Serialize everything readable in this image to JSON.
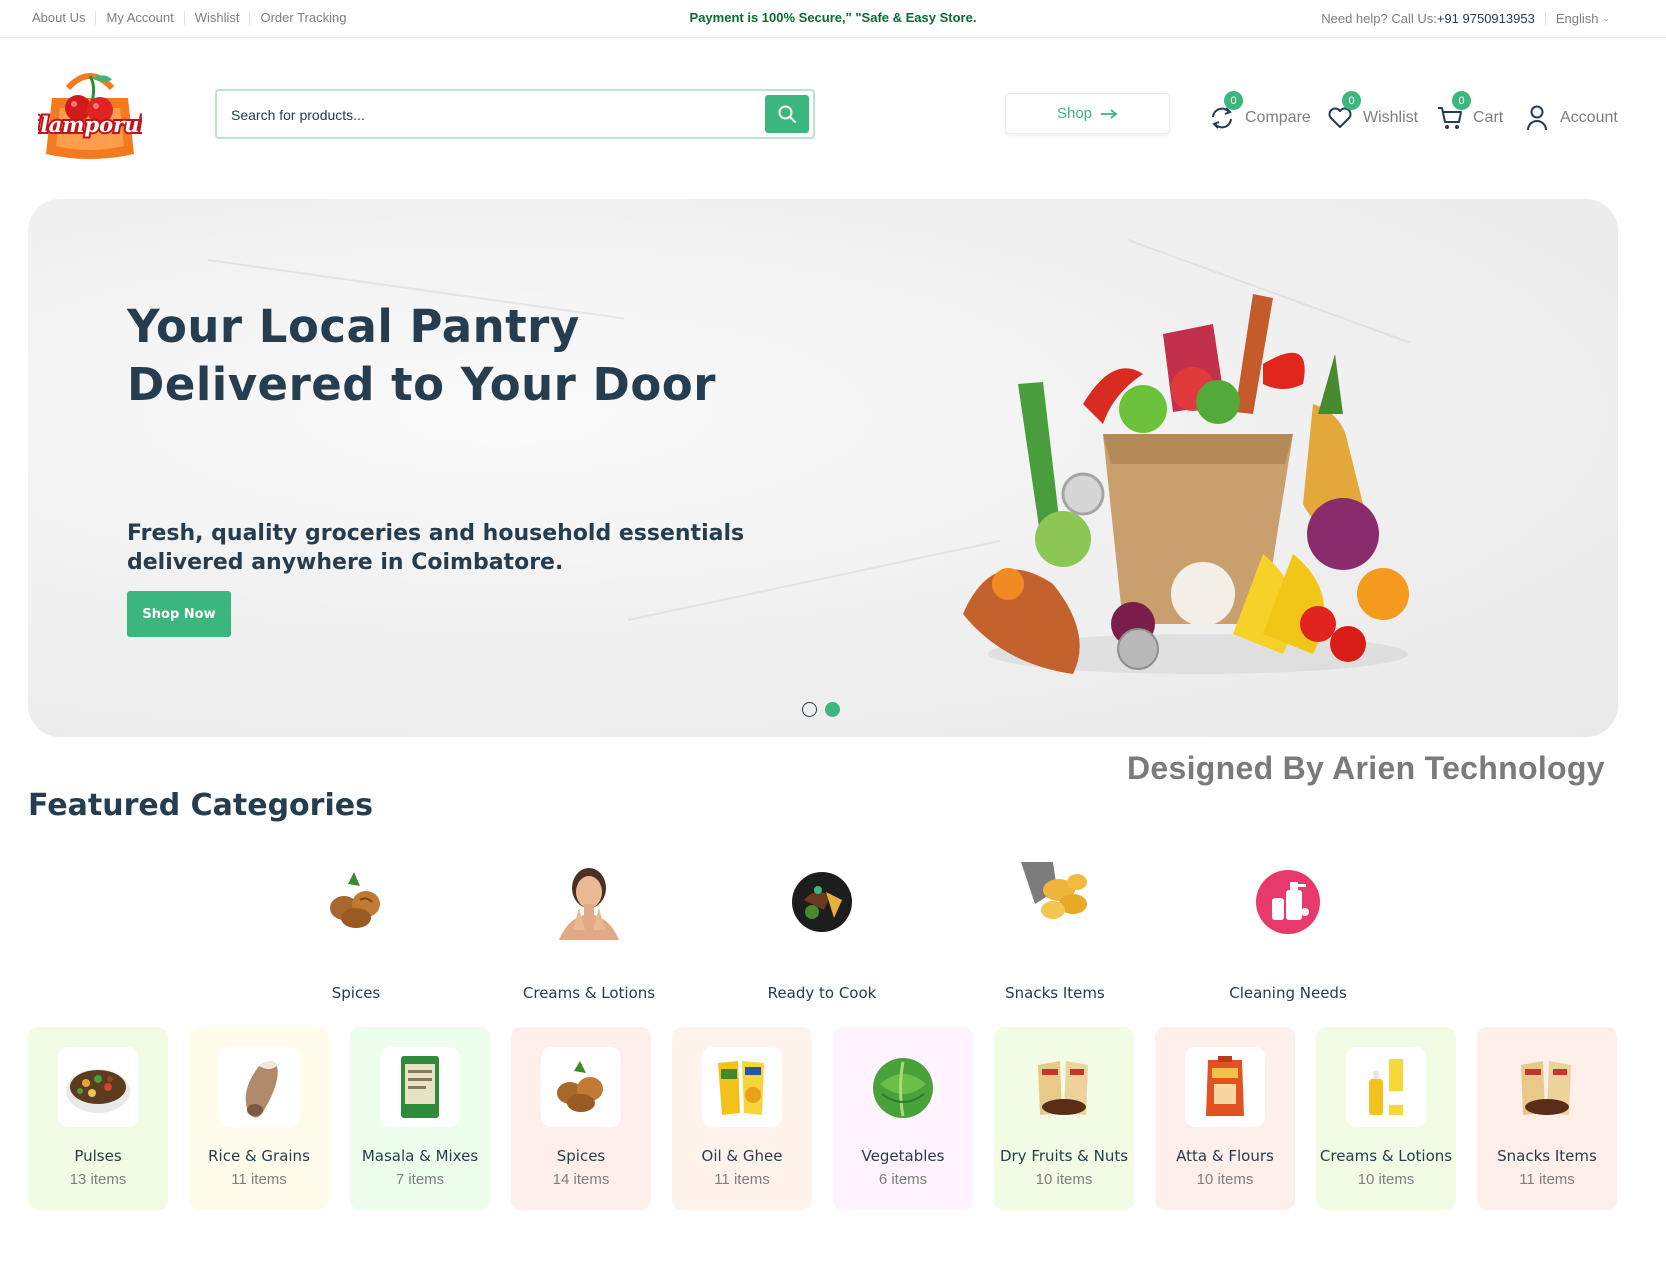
{
  "topbar": {
    "links": [
      "About Us",
      "My Account",
      "Wishlist",
      "Order Tracking"
    ],
    "notice": "Payment is 100% Secure,\" \"Safe & Easy Store.",
    "help_label": "Need help? Call Us:",
    "phone": "+91 9750913953",
    "language": "English"
  },
  "header": {
    "logo_text": "ilamporul",
    "search_placeholder": "Search for products...",
    "shop_label": "Shop",
    "compare": {
      "label": "Compare",
      "count": "0"
    },
    "wishlist": {
      "label": "Wishlist",
      "count": "0"
    },
    "cart": {
      "label": "Cart",
      "count": "0"
    },
    "account": {
      "label": "Account"
    }
  },
  "hero": {
    "title_line1": "Your Local Pantry",
    "title_line2": "Delivered to Your Door",
    "subtitle_line1": "Fresh, quality groceries and household essentials",
    "subtitle_line2": "delivered anywhere in Coimbatore.",
    "cta": "Shop Now",
    "active_slide": 2,
    "slide_count": 2
  },
  "watermark": "Designed By Arien Technology",
  "featured": {
    "title": "Featured Categories",
    "round_categories": [
      {
        "label": "Spices",
        "icon": "walnut-icon"
      },
      {
        "label": "Creams & Lotions",
        "icon": "woman-face-icon"
      },
      {
        "label": "Ready to Cook",
        "icon": "ready-meal-icon"
      },
      {
        "label": "Snacks Items",
        "icon": "chips-icon"
      },
      {
        "label": "Cleaning Needs",
        "icon": "cleaning-bottles-icon"
      }
    ],
    "cards": [
      {
        "name": "Pulses",
        "count": "13 items",
        "bg": "#f2fce4",
        "icon": "pulses-bowl-icon"
      },
      {
        "name": "Rice & Grains",
        "count": "11 items",
        "bg": "#fffceb",
        "icon": "grain-scoop-icon"
      },
      {
        "name": "Masala & Mixes",
        "count": "7 items",
        "bg": "#ecffec",
        "icon": "masala-pack-icon"
      },
      {
        "name": "Spices",
        "count": "14 items",
        "bg": "#feefea",
        "icon": "walnut-icon"
      },
      {
        "name": "Oil & Ghee",
        "count": "11 items",
        "bg": "#fff3eb",
        "icon": "oil-pack-icon"
      },
      {
        "name": "Vegetables",
        "count": "6 items",
        "bg": "#fff3ff",
        "icon": "cabbage-icon"
      },
      {
        "name": "Dry Fruits & Nuts",
        "count": "10 items",
        "bg": "#f2fce4",
        "icon": "snack-packs-icon"
      },
      {
        "name": "Atta & Flours",
        "count": "10 items",
        "bg": "#feefea",
        "icon": "flour-pack-icon"
      },
      {
        "name": "Creams & Lotions",
        "count": "10 items",
        "bg": "#f2fce4",
        "icon": "cream-bottles-icon"
      },
      {
        "name": "Snacks Items",
        "count": "11 items",
        "bg": "#feefea",
        "icon": "snack-packs-icon"
      }
    ]
  },
  "colors": {
    "accent": "#3bb77e",
    "heading": "#253d4e",
    "muted": "#7e7e7e",
    "notice": "#0c6b2f"
  }
}
